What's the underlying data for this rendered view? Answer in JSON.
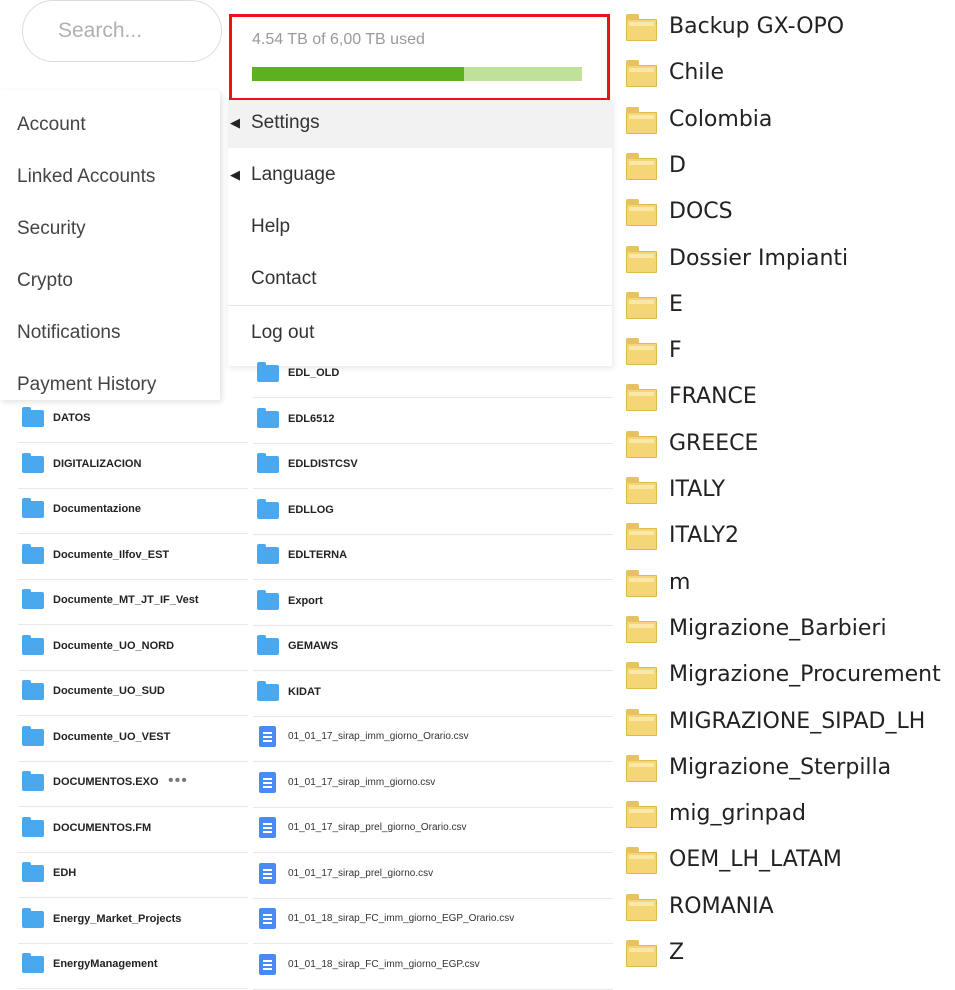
{
  "search": {
    "placeholder": "Search..."
  },
  "storage": {
    "text": "4.54 TB of 6,00 TB used",
    "used_fraction": 0.6424,
    "fill_color": "#5cb21e",
    "track_color": "#bfe29a",
    "highlight_color": "#e8141c"
  },
  "account_menu": {
    "items": [
      "Account",
      "Linked Accounts",
      "Security",
      "Crypto",
      "Notifications",
      "Payment History"
    ]
  },
  "settings_menu": {
    "items": [
      {
        "label": "Settings",
        "has_submenu": true
      },
      {
        "label": "Language",
        "has_submenu": true
      },
      {
        "label": "Help",
        "has_submenu": false
      },
      {
        "label": "Contact",
        "has_submenu": false
      },
      {
        "label": "Log out",
        "has_submenu": false
      }
    ]
  },
  "left_files": [
    {
      "name": "DATOS",
      "type": "folder"
    },
    {
      "name": "DIGITALIZACION",
      "type": "folder"
    },
    {
      "name": "Documentazione",
      "type": "folder"
    },
    {
      "name": "Documente_Ilfov_EST",
      "type": "folder"
    },
    {
      "name": "Documente_MT_JT_IF_Vest",
      "type": "folder"
    },
    {
      "name": "Documente_UO_NORD",
      "type": "folder"
    },
    {
      "name": "Documente_UO_SUD",
      "type": "folder"
    },
    {
      "name": "Documente_UO_VEST",
      "type": "folder"
    },
    {
      "name": "DOCUMENTOS.EXO",
      "type": "folder",
      "more": "•••"
    },
    {
      "name": "DOCUMENTOS.FM",
      "type": "folder"
    },
    {
      "name": "EDH",
      "type": "folder"
    },
    {
      "name": "Energy_Market_Projects",
      "type": "folder"
    },
    {
      "name": "EnergyManagement",
      "type": "folder"
    }
  ],
  "middle_files": [
    {
      "name": "EDL_OLD",
      "type": "folder"
    },
    {
      "name": "EDL6512",
      "type": "folder"
    },
    {
      "name": "EDLDISTCSV",
      "type": "folder"
    },
    {
      "name": "EDLLOG",
      "type": "folder"
    },
    {
      "name": "EDLTERNA",
      "type": "folder"
    },
    {
      "name": "Export",
      "type": "folder"
    },
    {
      "name": "GEMAWS",
      "type": "folder"
    },
    {
      "name": "KIDAT",
      "type": "folder"
    },
    {
      "name": "01_01_17_sirap_imm_giorno_Orario.csv",
      "type": "file"
    },
    {
      "name": "01_01_17_sirap_imm_giorno.csv",
      "type": "file"
    },
    {
      "name": "01_01_17_sirap_prel_giorno_Orario.csv",
      "type": "file"
    },
    {
      "name": "01_01_17_sirap_prel_giorno.csv",
      "type": "file"
    },
    {
      "name": "01_01_18_sirap_FC_imm_giorno_EGP_Orario.csv",
      "type": "file"
    },
    {
      "name": "01_01_18_sirap_FC_imm_giorno_EGP.csv",
      "type": "file"
    }
  ],
  "explorer_folders": [
    "Backup GX-OPO",
    "Chile",
    "Colombia",
    "D",
    "DOCS",
    "Dossier Impianti",
    "E",
    "F",
    "FRANCE",
    "GREECE",
    "ITALY",
    "ITALY2",
    "m",
    "Migrazione_Barbieri",
    "Migrazione_Procurement",
    "MIGRAZIONE_SIPAD_LH",
    "Migrazione_Sterpilla",
    "mig_grinpad",
    "OEM_LH_LATAM",
    "ROMANIA",
    "Z"
  ]
}
